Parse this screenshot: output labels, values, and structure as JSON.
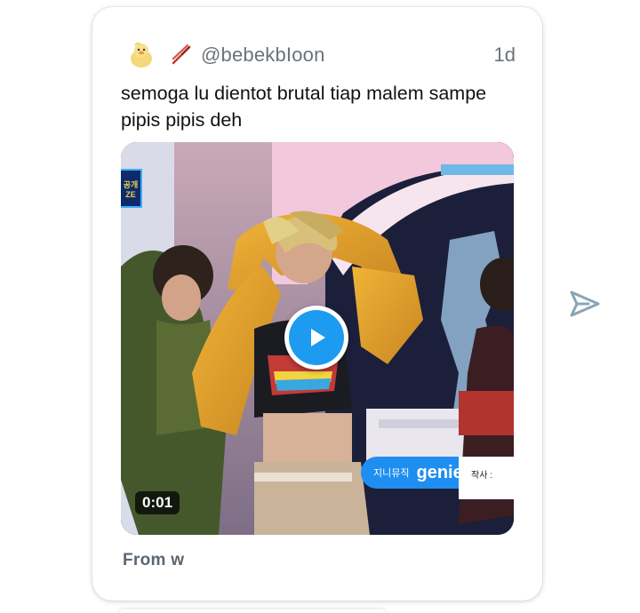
{
  "post": {
    "handle": "@bebekbIoon",
    "time": "1d",
    "text_line1": "semoga lu dientot brutal tiap malem sampe",
    "text_line2": "pipis pipis deh",
    "footer": "From  w"
  },
  "media": {
    "duration": "0:01",
    "broadcaster_small": "지니뮤직",
    "broadcaster_big": "genie",
    "credit": "작사 :",
    "ticker_top": "공개",
    "ticker_bottom": "ZE"
  },
  "icons": {
    "avatar": "duck-avatar-icon",
    "chopsticks": "chopsticks-emoji-icon",
    "play": "play-icon",
    "send": "send-icon"
  },
  "colors": {
    "accent": "#1d9bf0",
    "muted_text": "#6b7378",
    "body_text": "#111111"
  }
}
